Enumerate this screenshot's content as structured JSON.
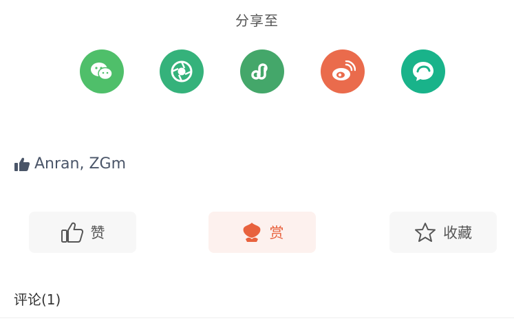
{
  "share": {
    "title": "分享至",
    "targets": [
      {
        "name": "wechat",
        "icon": "wechat-icon",
        "color": "#4fbf6a"
      },
      {
        "name": "moments",
        "icon": "moments-icon",
        "color": "#35b27b"
      },
      {
        "name": "mini-program",
        "icon": "mini-program-icon",
        "color": "#44a76a"
      },
      {
        "name": "weibo",
        "icon": "weibo-icon",
        "color": "#ea6b4c"
      },
      {
        "name": "other",
        "icon": "chat-bubble-icon",
        "color": "#19b38a"
      }
    ]
  },
  "likes": {
    "icon": "thumb-up-filled-icon",
    "users": "Anran, ZGm"
  },
  "actions": {
    "like_label": "赞",
    "like_icon": "thumb-up-outline-icon",
    "reward_label": "赏",
    "reward_icon": "reward-icon",
    "favorite_label": "收藏",
    "favorite_icon": "star-outline-icon",
    "reward_color": "#e8623e"
  },
  "comments": {
    "title": "评论(1)"
  }
}
